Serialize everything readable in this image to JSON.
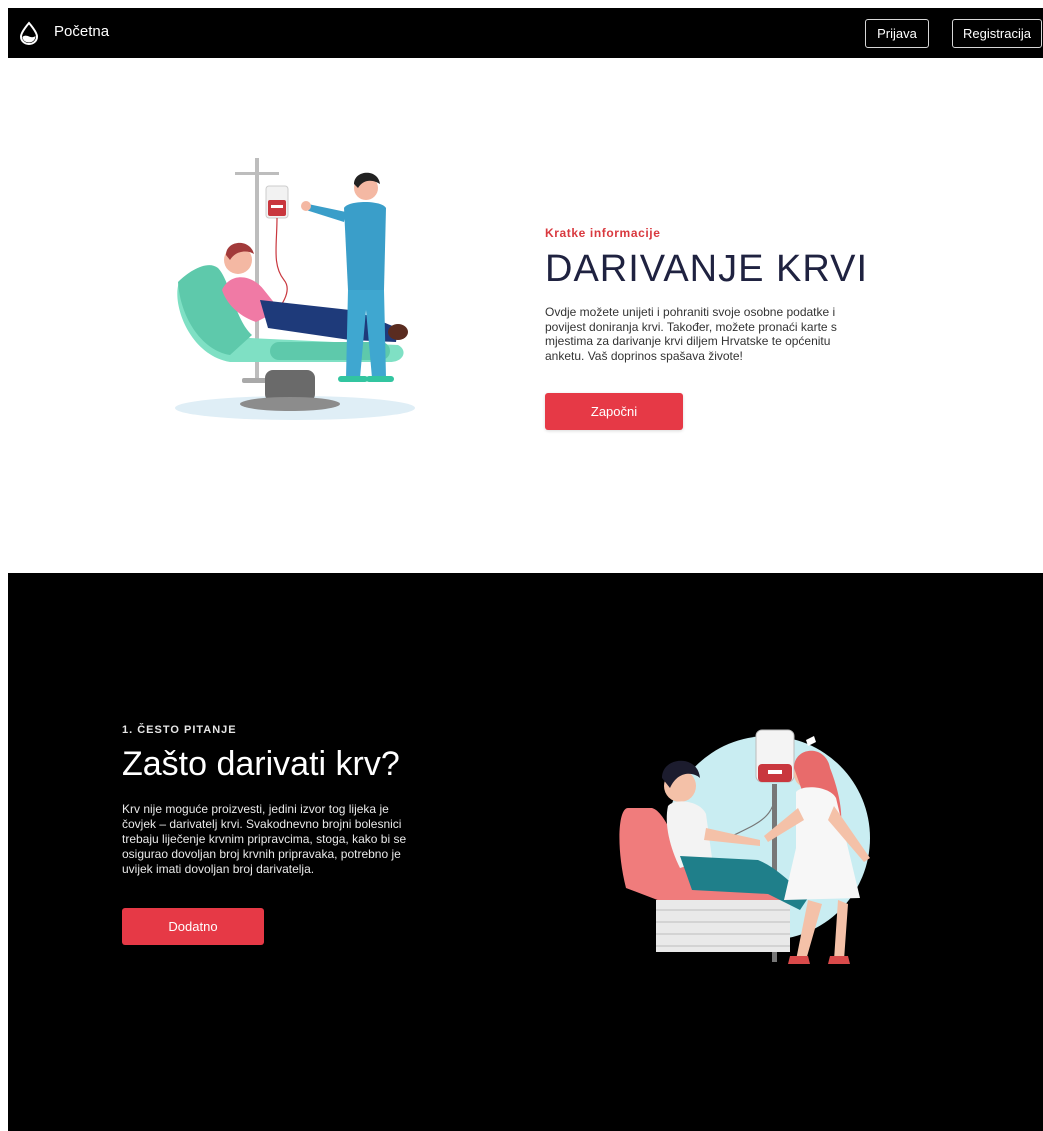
{
  "nav": {
    "logo_icon": "blood-drop-icon",
    "home": "Početna",
    "login": "Prijava",
    "register": "Registracija"
  },
  "hero": {
    "kicker": "Kratke informacije",
    "title": "DARIVANJE KRVI",
    "text": "Ovdje možete unijeti i pohraniti svoje osobne podatke i povijest doniranja krvi. Također, možete pronaći karte s mjestima za darivanje krvi diljem Hrvatske te općenitu anketu. Vaš doprinos spašava živote!",
    "button": "Započni",
    "illustration": "blood-donation-chair-illustration"
  },
  "faq": {
    "kicker": "1. ČESTO PITANJE",
    "title": "Zašto darivati krv?",
    "text": "Krv nije moguće proizvesti, jedini izvor tog lijeka je čovjek – darivatelj krvi. Svakodnevno brojni bolesnici trebaju liječenje krvnim pripravcima, stoga, kako bi se osigurao dovoljan broj krvnih pripravaka, potrebno je uvijek imati dovoljan broj darivatelja.",
    "button": "Dodatno",
    "illustration": "nurse-donor-illustration"
  },
  "colors": {
    "accent": "#e63946",
    "dark": "#000000",
    "title": "#1f2240"
  }
}
